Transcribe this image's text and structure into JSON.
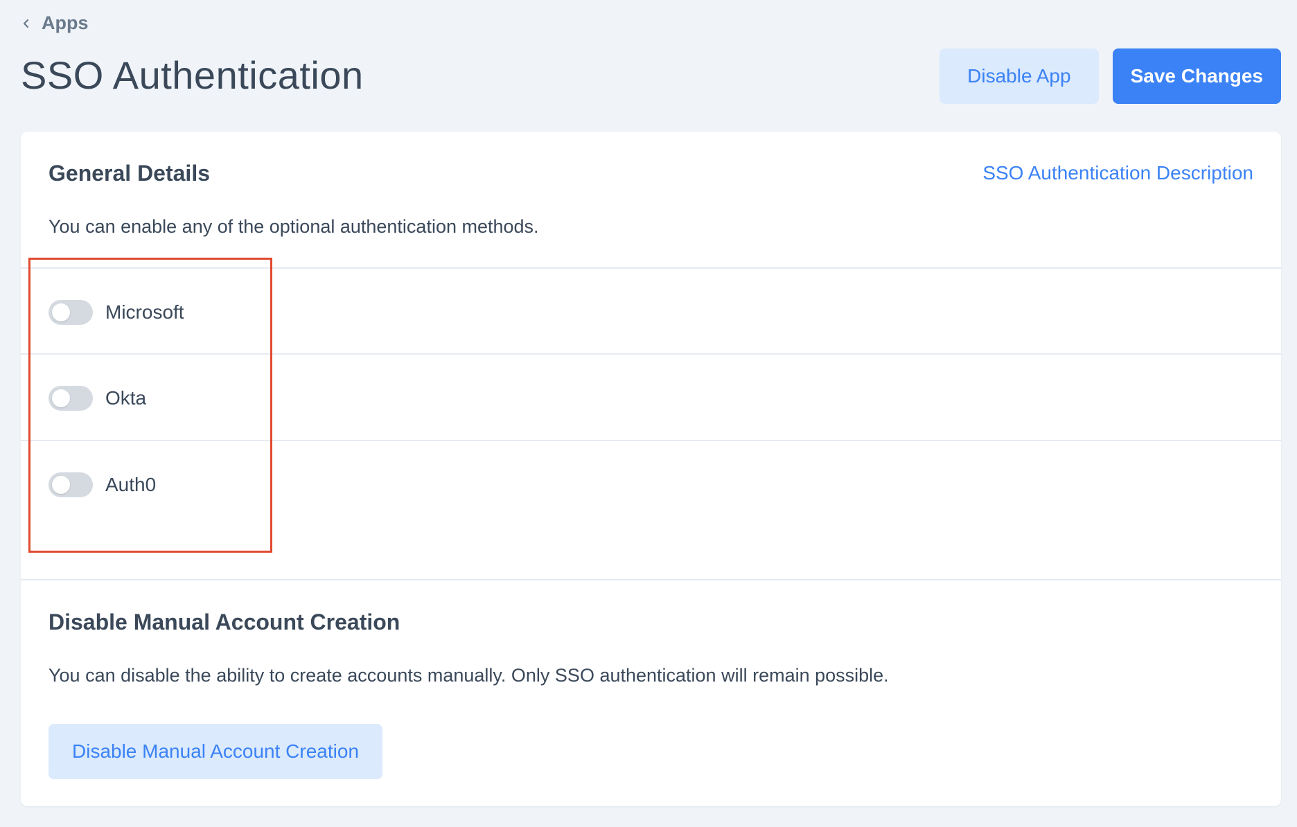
{
  "breadcrumb": {
    "label": "Apps",
    "icon": "chevron-left-icon"
  },
  "page": {
    "title": "SSO Authentication"
  },
  "header": {
    "disable_app_label": "Disable App",
    "save_label": "Save Changes"
  },
  "general": {
    "title": "General Details",
    "link_label": "SSO Authentication Description",
    "description": "You can enable any of the optional authentication methods.",
    "providers": [
      {
        "label": "Microsoft",
        "enabled": false
      },
      {
        "label": "Okta",
        "enabled": false
      },
      {
        "label": "Auth0",
        "enabled": false
      }
    ]
  },
  "manual": {
    "title": "Disable Manual Account Creation",
    "description": "You can disable the ability to create accounts manually. Only SSO authentication will remain possible.",
    "button_label": "Disable Manual Account Creation"
  },
  "colors": {
    "accent": "#3b82f6",
    "accent_light": "#dbeafc",
    "highlight": "#e04a2f",
    "background": "#f0f4f8"
  }
}
